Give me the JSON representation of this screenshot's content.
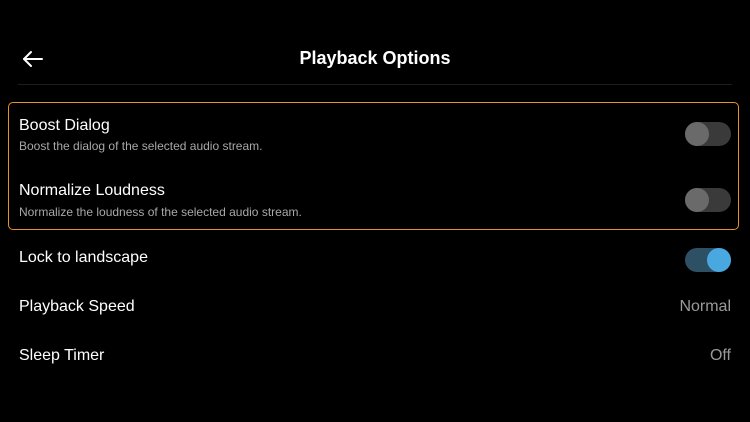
{
  "header": {
    "title": "Playback Options",
    "back_icon": "arrow-left-icon"
  },
  "settings": {
    "boost_dialog": {
      "label": "Boost Dialog",
      "description": "Boost the dialog of the selected audio stream.",
      "enabled": false
    },
    "normalize_loudness": {
      "label": "Normalize Loudness",
      "description": "Normalize the loudness of the selected audio stream.",
      "enabled": false
    },
    "lock_landscape": {
      "label": "Lock to landscape",
      "enabled": true
    },
    "playback_speed": {
      "label": "Playback Speed",
      "value": "Normal"
    },
    "sleep_timer": {
      "label": "Sleep Timer",
      "value": "Off"
    }
  },
  "colors": {
    "background": "#000000",
    "highlight_border": "#e8902a",
    "toggle_on_knob": "#4aa8e0",
    "toggle_on_track": "#2d5064",
    "toggle_off_knob": "#6a6a6a",
    "toggle_off_track": "#3a3a3a"
  }
}
